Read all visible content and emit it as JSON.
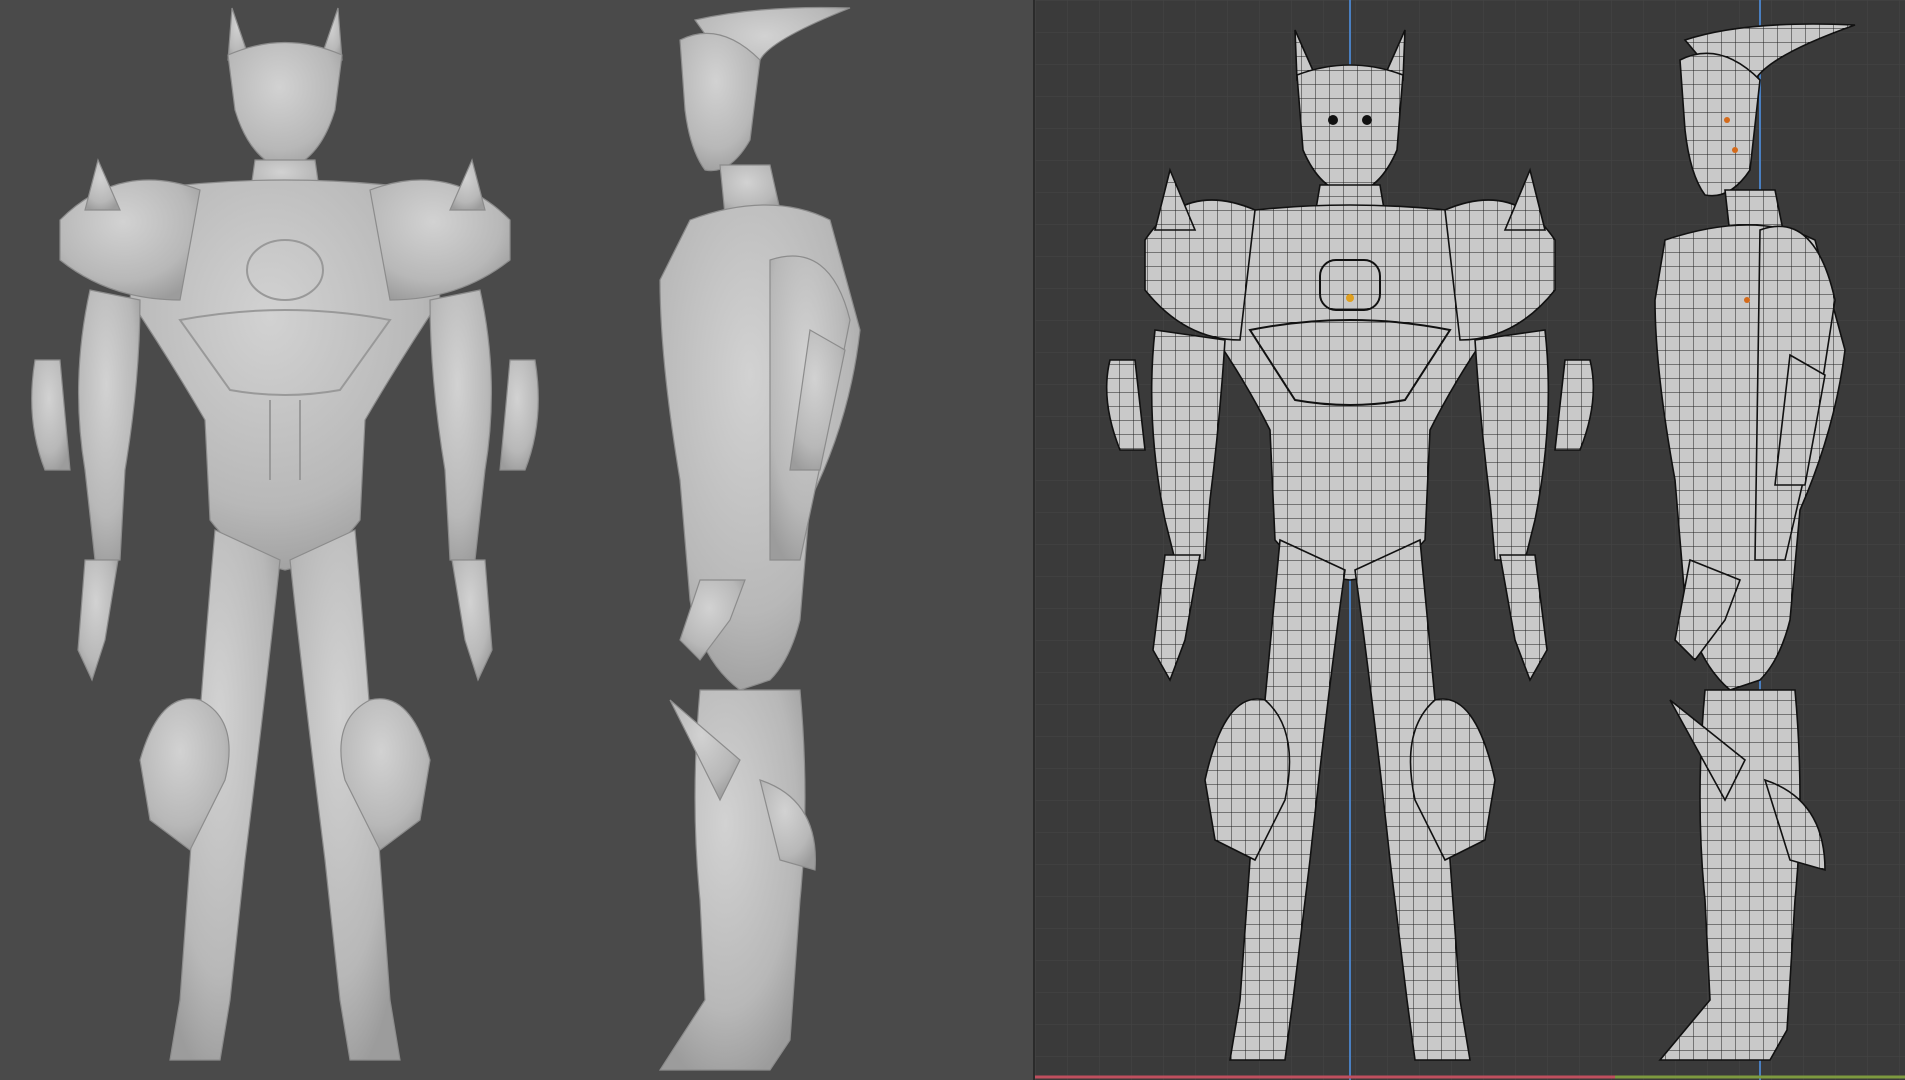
{
  "panels": {
    "left": {
      "name": "sculpt-viewport",
      "shading": "solid-matcap"
    },
    "right": {
      "name": "wireframe-viewport",
      "shading": "wireframe-overlay"
    }
  },
  "colors": {
    "sculpt_bg": "#4a4a4a",
    "wire_bg": "#3a3a3a",
    "mesh_fill": "#c9c9c9",
    "wire_line": "#1e1e1e",
    "grid_minor": "#454545",
    "grid_major": "#4e4e4e",
    "axis_x": "#c04f5e",
    "axis_y": "#7d9a3f",
    "axis_z": "#4a7fc0",
    "vertex_highlight": "#e0a020"
  }
}
